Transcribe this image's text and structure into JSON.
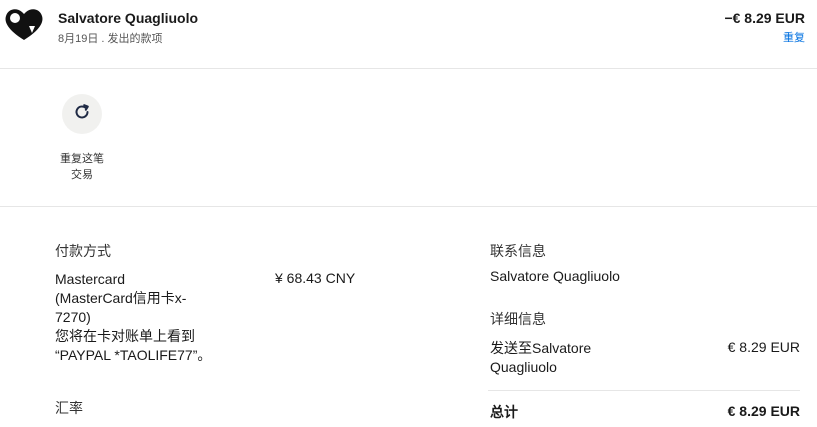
{
  "header": {
    "merchant": "Salvatore Quagliuolo",
    "subline": "8月19日 . 发出的款项",
    "amount": "−€ 8.29 EUR",
    "repeat_link": "重复"
  },
  "actions": {
    "repeat_label_line1": "重复这笔",
    "repeat_label_line2": "交易",
    "icon": "refresh-icon"
  },
  "payment": {
    "title": "付款方式",
    "method_line1": "Mastercard",
    "method_line2": "(MasterCard信用卡x-",
    "method_line3": "7270)",
    "method_line4": "您将在卡对账单上看到",
    "method_line5": "“PAYPAL *TAOLIFE77”。",
    "amount": "¥ 68.43 CNY",
    "exchange_title": "汇率"
  },
  "contact": {
    "title": "联系信息",
    "name": "Salvatore Quagliuolo"
  },
  "detail": {
    "title": "详细信息",
    "sent_to_line1": "发送至Salvatore",
    "sent_to_line2": "Quagliuolo",
    "sent_amount": "€ 8.29 EUR",
    "total_label": "总计",
    "total_amount": "€ 8.29 EUR"
  },
  "colors": {
    "link": "#0070e0",
    "icon_circle": "#f1f1ef"
  }
}
